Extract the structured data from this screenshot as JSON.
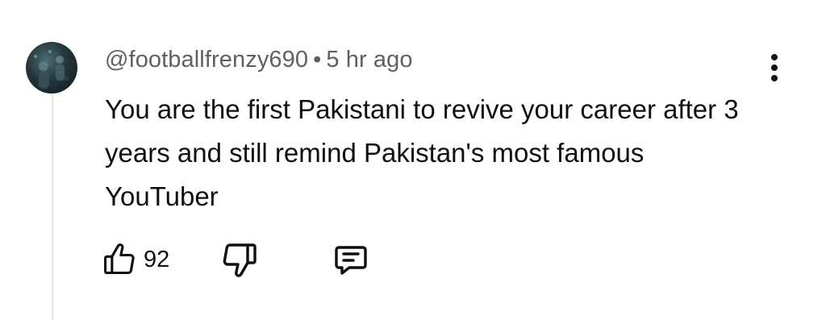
{
  "comment": {
    "author": "@footballfrenzy690",
    "separator": "•",
    "timestamp": "5 hr ago",
    "text": "You are the first Pakistani to revive your career after 3 years and still remind Pakistan's most famous YouTuber",
    "like_count": "92"
  },
  "icons": {
    "like": "thumbs-up-icon",
    "dislike": "thumbs-down-icon",
    "reply": "reply-comment-icon",
    "more": "more-vertical-icon"
  },
  "colors": {
    "text_primary": "#0f0f0f",
    "text_secondary": "#606060",
    "thread_line": "#e5e5e5",
    "background": "#ffffff"
  }
}
